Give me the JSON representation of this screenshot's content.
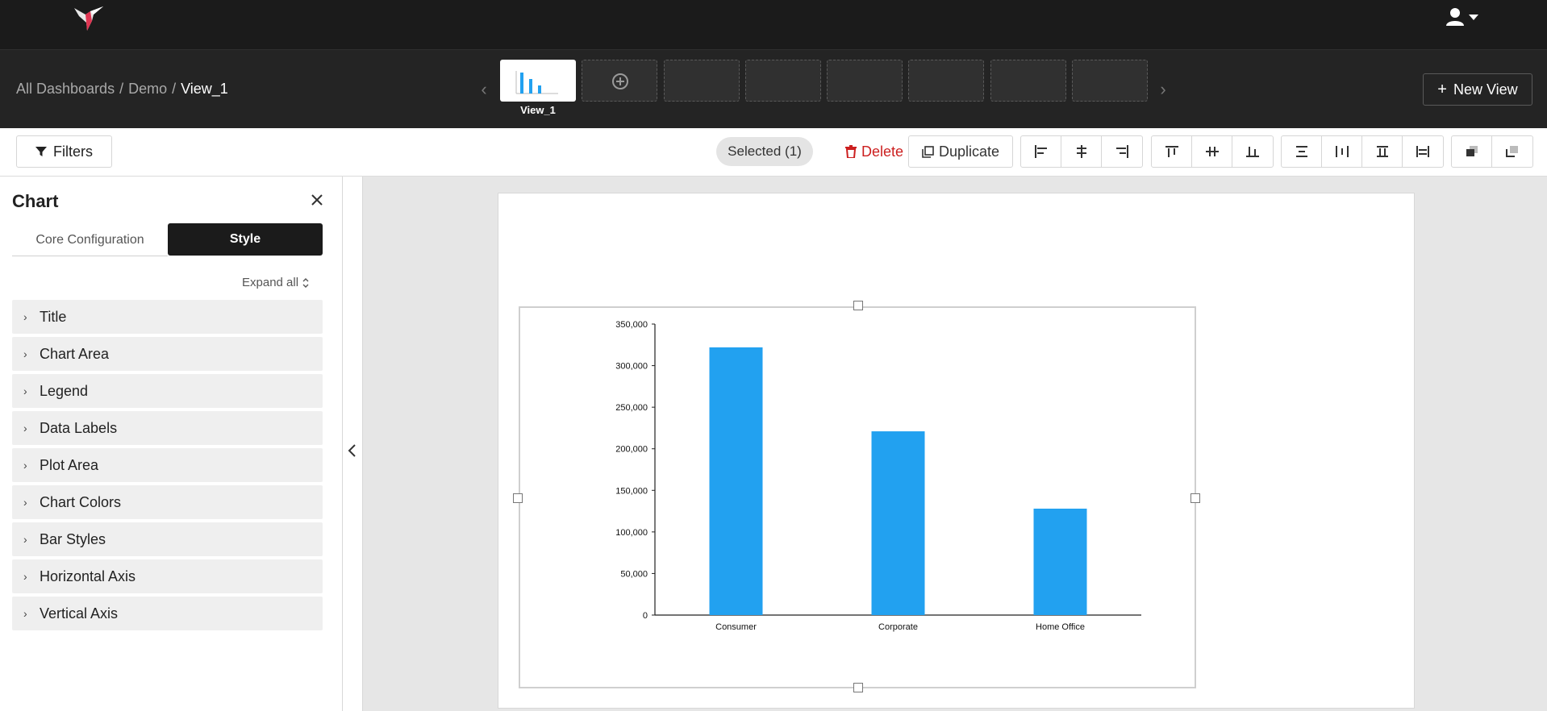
{
  "header": {
    "logo_icon": "hummingbird-logo",
    "user_icon": "user-icon"
  },
  "breadcrumb": {
    "items": [
      "All Dashboards",
      "Demo"
    ],
    "current": "View_1",
    "separator": "/"
  },
  "views": {
    "active_label": "View_1",
    "add_icon": "plus-circle-icon",
    "empty_slots": 6
  },
  "new_view": {
    "label": "New View",
    "icon": "plus-icon"
  },
  "toolbar": {
    "filters_label": "Filters",
    "selected_label": "Selected (1)",
    "delete_label": "Delete",
    "duplicate_label": "Duplicate",
    "align_icons": [
      "align-left-icon",
      "align-center-h-icon",
      "align-right-icon"
    ],
    "valign_icons": [
      "align-top-icon",
      "align-middle-v-icon",
      "align-bottom-icon"
    ],
    "distribute_icons": [
      "distribute-top-icon",
      "distribute-h-icon",
      "distribute-bottom-icon",
      "distribute-v-icon"
    ],
    "layer_icons": [
      "bring-forward-icon",
      "send-backward-icon"
    ]
  },
  "panel": {
    "title": "Chart",
    "tab_core": "Core Configuration",
    "tab_style": "Style",
    "expand_all": "Expand all",
    "sections": [
      "Title",
      "Chart Area",
      "Legend",
      "Data Labels",
      "Plot Area",
      "Chart Colors",
      "Bar Styles",
      "Horizontal Axis",
      "Vertical Axis"
    ]
  },
  "colors": {
    "bar": "#22a1f0",
    "topbar": "#1b1b1b",
    "delete": "#cc1f1f"
  },
  "chart_data": {
    "type": "bar",
    "categories": [
      "Consumer",
      "Corporate",
      "Home Office"
    ],
    "values": [
      322000,
      221000,
      128000
    ],
    "ylim": [
      0,
      350000
    ],
    "yticks": [
      0,
      50000,
      100000,
      150000,
      200000,
      250000,
      300000,
      350000
    ],
    "ytick_labels": [
      "0",
      "50,000",
      "100,000",
      "150,000",
      "200,000",
      "250,000",
      "300,000",
      "350,000"
    ],
    "title": "",
    "xlabel": "",
    "ylabel": "",
    "grid": false,
    "legend": "none"
  }
}
